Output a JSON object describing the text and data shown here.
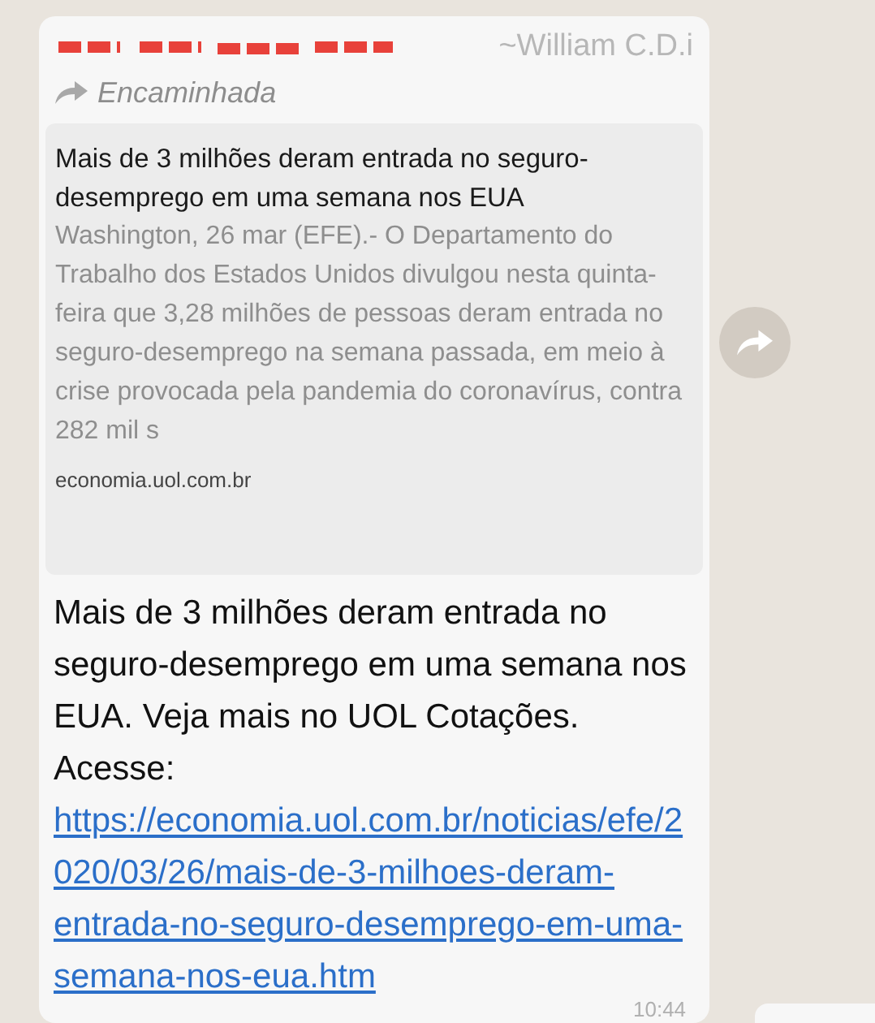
{
  "message": {
    "sender": "~William C.D.i",
    "forwarded_label": "Encaminhada",
    "preview": {
      "title": "Mais de 3 milhões deram entrada no seguro-desemprego em uma semana nos EUA",
      "description": "Washington, 26 mar (EFE).- O Departamento do Trabalho dos Estados Unidos divulgou nesta quinta-feira que 3,28 milhões de pessoas deram entrada no seguro-desemprego na semana passada, em meio à crise provocada pela pandemia do coronavírus, contra 282 mil s",
      "domain": "economia.uol.com.br"
    },
    "text": "Mais de 3 milhões deram entrada no seguro-desemprego em uma semana nos EUA. Veja mais no UOL Cotações. Acesse: ",
    "link": "https://economia.uol.com.br/noticias/efe/2020/03/26/mais-de-3-milhoes-deram-entrada-no-seguro-desemprego-em-uma-semana-nos-eua.htm",
    "time": "10:44"
  }
}
